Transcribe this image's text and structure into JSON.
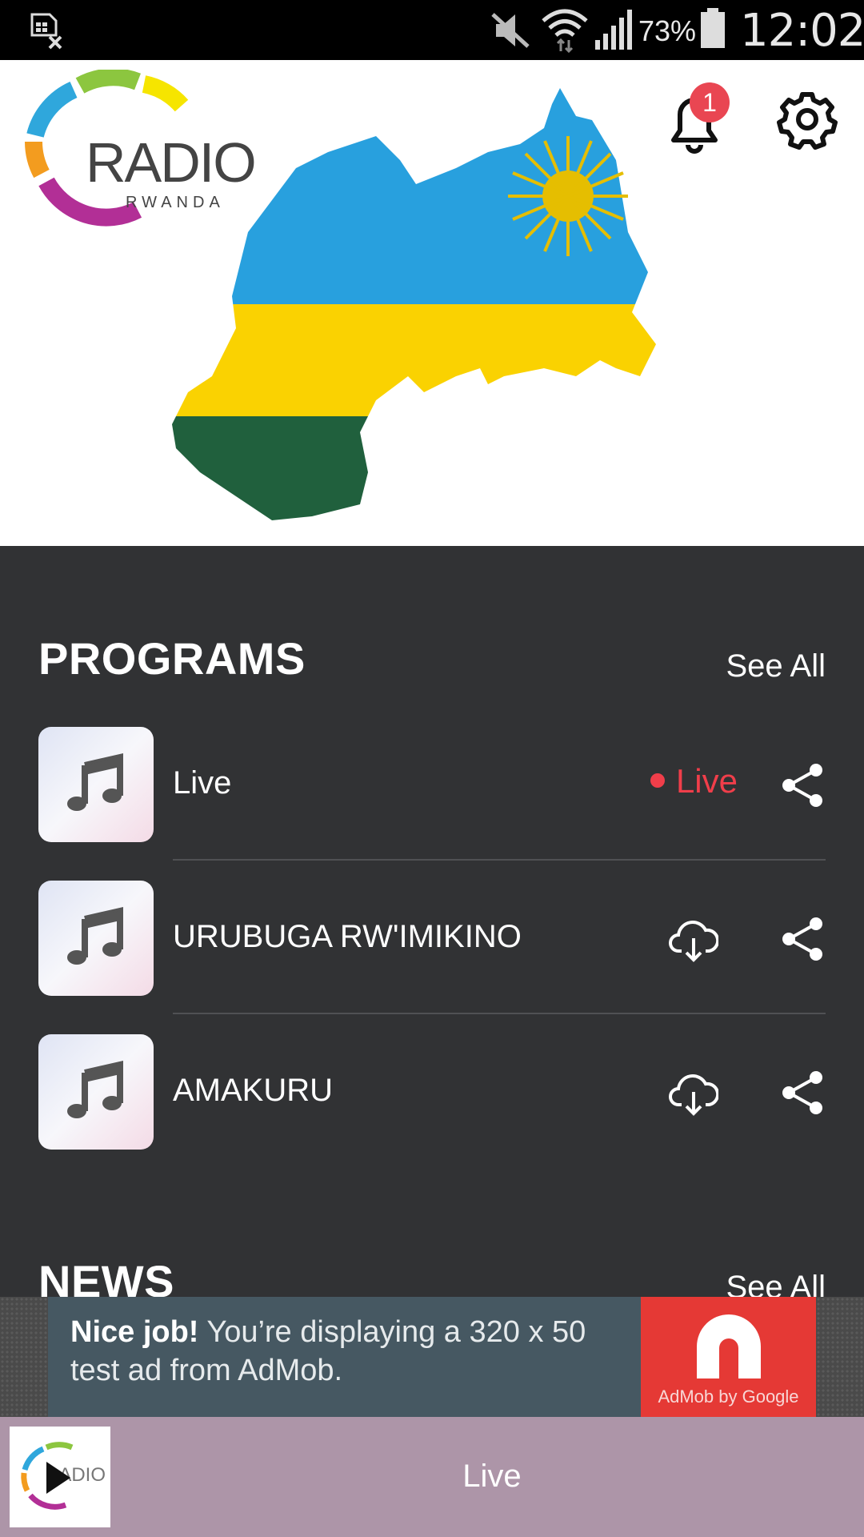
{
  "status_bar": {
    "battery": "73%",
    "time": "12:02"
  },
  "header": {
    "logo_text": "RADIO",
    "logo_subtext": "RWANDA",
    "notification_count": "1"
  },
  "programs": {
    "title": "PROGRAMS",
    "see_all": "See All",
    "items": [
      {
        "title": "Live",
        "status": "Live",
        "action": "live"
      },
      {
        "title": "URUBUGA RW'IMIKINO",
        "action": "download"
      },
      {
        "title": "AMAKURU",
        "action": "download"
      }
    ]
  },
  "news": {
    "title": "NEWS",
    "see_all": "See All"
  },
  "ad": {
    "headline": "Nice job!",
    "body": " You’re displaying a 320 x 50 test ad from AdMob.",
    "brand": "AdMob by Google"
  },
  "player": {
    "now_playing": "Live"
  },
  "colors": {
    "live_red": "#f03e4a",
    "player_bar": "#ad95a8",
    "background": "#313234"
  }
}
